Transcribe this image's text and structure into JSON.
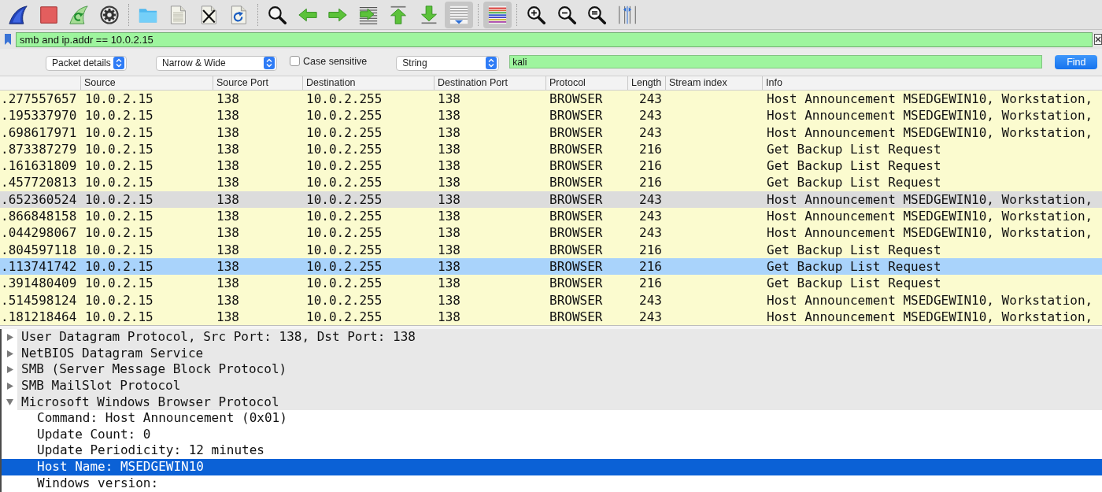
{
  "toolbar": {
    "groups": [
      [
        {
          "on": false
        },
        {
          "on": false
        },
        {
          "on": false
        },
        {
          "on": false
        }
      ],
      [
        {
          "on": false
        },
        {
          "on": false
        },
        {
          "on": false
        },
        {
          "on": false
        }
      ],
      [
        {
          "on": false
        },
        {
          "on": false
        },
        {
          "on": false
        },
        {
          "on": false
        },
        {
          "on": false
        },
        {
          "on": false
        },
        {
          "on": true
        }
      ],
      [
        {
          "on": true
        }
      ],
      [
        {
          "on": false
        },
        {
          "on": false
        },
        {
          "on": false
        },
        {
          "on": false
        }
      ]
    ]
  },
  "display_filter": {
    "value": "smb and ip.addr == 10.0.2.15"
  },
  "find_bar": {
    "search_in": "Packet details",
    "charset": "Narrow & Wide",
    "case_sensitive": {
      "label": "Case sensitive",
      "checked": false
    },
    "search_type": "String",
    "query": {
      "value": "kali"
    },
    "button": "Find"
  },
  "packet_list": {
    "columns": [
      {
        "label": "Source"
      },
      {
        "label": "Source Port"
      },
      {
        "label": "Destination"
      },
      {
        "label": "Destination Port"
      },
      {
        "label": "Protocol"
      },
      {
        "label": "Length"
      },
      {
        "label": "Stream index"
      },
      {
        "label": "Info"
      }
    ],
    "rows": [
      {
        "column_1": ".277557657",
        "source": "10.0.2.15",
        "source_port": "138",
        "destination": "10.0.2.255",
        "destination_port": "138",
        "protocol": "BROWSER",
        "length": "243",
        "info": "Host Announcement MSEDGEWIN10, Workstation,",
        "hovered": false,
        "selected": false
      },
      {
        "column_1": ".195337970",
        "source": "10.0.2.15",
        "source_port": "138",
        "destination": "10.0.2.255",
        "destination_port": "138",
        "protocol": "BROWSER",
        "length": "243",
        "info": "Host Announcement MSEDGEWIN10, Workstation,",
        "hovered": false,
        "selected": false
      },
      {
        "column_1": ".698617971",
        "source": "10.0.2.15",
        "source_port": "138",
        "destination": "10.0.2.255",
        "destination_port": "138",
        "protocol": "BROWSER",
        "length": "243",
        "info": "Host Announcement MSEDGEWIN10, Workstation,",
        "hovered": false,
        "selected": false
      },
      {
        "column_1": ".873387279",
        "source": "10.0.2.15",
        "source_port": "138",
        "destination": "10.0.2.255",
        "destination_port": "138",
        "protocol": "BROWSER",
        "length": "216",
        "info": "Get Backup List Request",
        "hovered": false,
        "selected": false
      },
      {
        "column_1": ".161631809",
        "source": "10.0.2.15",
        "source_port": "138",
        "destination": "10.0.2.255",
        "destination_port": "138",
        "protocol": "BROWSER",
        "length": "216",
        "info": "Get Backup List Request",
        "hovered": false,
        "selected": false
      },
      {
        "column_1": ".457720813",
        "source": "10.0.2.15",
        "source_port": "138",
        "destination": "10.0.2.255",
        "destination_port": "138",
        "protocol": "BROWSER",
        "length": "216",
        "info": "Get Backup List Request",
        "hovered": false,
        "selected": false
      },
      {
        "column_1": ".652360524",
        "source": "10.0.2.15",
        "source_port": "138",
        "destination": "10.0.2.255",
        "destination_port": "138",
        "protocol": "BROWSER",
        "length": "243",
        "info": "Host Announcement MSEDGEWIN10, Workstation,",
        "hovered": true,
        "selected": false
      },
      {
        "column_1": ".866848158",
        "source": "10.0.2.15",
        "source_port": "138",
        "destination": "10.0.2.255",
        "destination_port": "138",
        "protocol": "BROWSER",
        "length": "243",
        "info": "Host Announcement MSEDGEWIN10, Workstation,",
        "hovered": false,
        "selected": false
      },
      {
        "column_1": ".044298067",
        "source": "10.0.2.15",
        "source_port": "138",
        "destination": "10.0.2.255",
        "destination_port": "138",
        "protocol": "BROWSER",
        "length": "243",
        "info": "Host Announcement MSEDGEWIN10, Workstation,",
        "hovered": false,
        "selected": false
      },
      {
        "column_1": ".804597118",
        "source": "10.0.2.15",
        "source_port": "138",
        "destination": "10.0.2.255",
        "destination_port": "138",
        "protocol": "BROWSER",
        "length": "216",
        "info": "Get Backup List Request",
        "hovered": false,
        "selected": false
      },
      {
        "column_1": ".113741742",
        "source": "10.0.2.15",
        "source_port": "138",
        "destination": "10.0.2.255",
        "destination_port": "138",
        "protocol": "BROWSER",
        "length": "216",
        "info": "Get Backup List Request",
        "hovered": false,
        "selected": true
      },
      {
        "column_1": ".391480409",
        "source": "10.0.2.15",
        "source_port": "138",
        "destination": "10.0.2.255",
        "destination_port": "138",
        "protocol": "BROWSER",
        "length": "216",
        "info": "Get Backup List Request",
        "hovered": false,
        "selected": false
      },
      {
        "column_1": ".514598124",
        "source": "10.0.2.15",
        "source_port": "138",
        "destination": "10.0.2.255",
        "destination_port": "138",
        "protocol": "BROWSER",
        "length": "243",
        "info": "Host Announcement MSEDGEWIN10, Workstation,",
        "hovered": false,
        "selected": false
      },
      {
        "column_1": ".181218464",
        "source": "10.0.2.15",
        "source_port": "138",
        "destination": "10.0.2.255",
        "destination_port": "138",
        "protocol": "BROWSER",
        "length": "243",
        "info": "Host Announcement MSEDGEWIN10, Workstation,",
        "hovered": false,
        "selected": false
      }
    ]
  },
  "packet_details": {
    "items": [
      {
        "label": "User Datagram Protocol, Src Port: 138, Dst Port: 138",
        "expanded": false,
        "selected": false
      },
      {
        "label": "NetBIOS Datagram Service",
        "expanded": false,
        "selected": false
      },
      {
        "label": "SMB (Server Message Block Protocol)",
        "expanded": false,
        "selected": false
      },
      {
        "label": "SMB MailSlot Protocol",
        "expanded": false,
        "selected": false
      },
      {
        "label": "Microsoft Windows Browser Protocol",
        "expanded": true,
        "selected": false,
        "children": [
          {
            "label": "Command: Host Announcement (0x01)",
            "selected": false
          },
          {
            "label": "Update Count: 0",
            "selected": false
          },
          {
            "label": "Update Periodicity: 12 minutes",
            "selected": false
          },
          {
            "label": "Host Name: MSEDGEWIN10",
            "selected": true
          },
          {
            "label": "Windows version:",
            "selected": false
          }
        ]
      }
    ]
  }
}
